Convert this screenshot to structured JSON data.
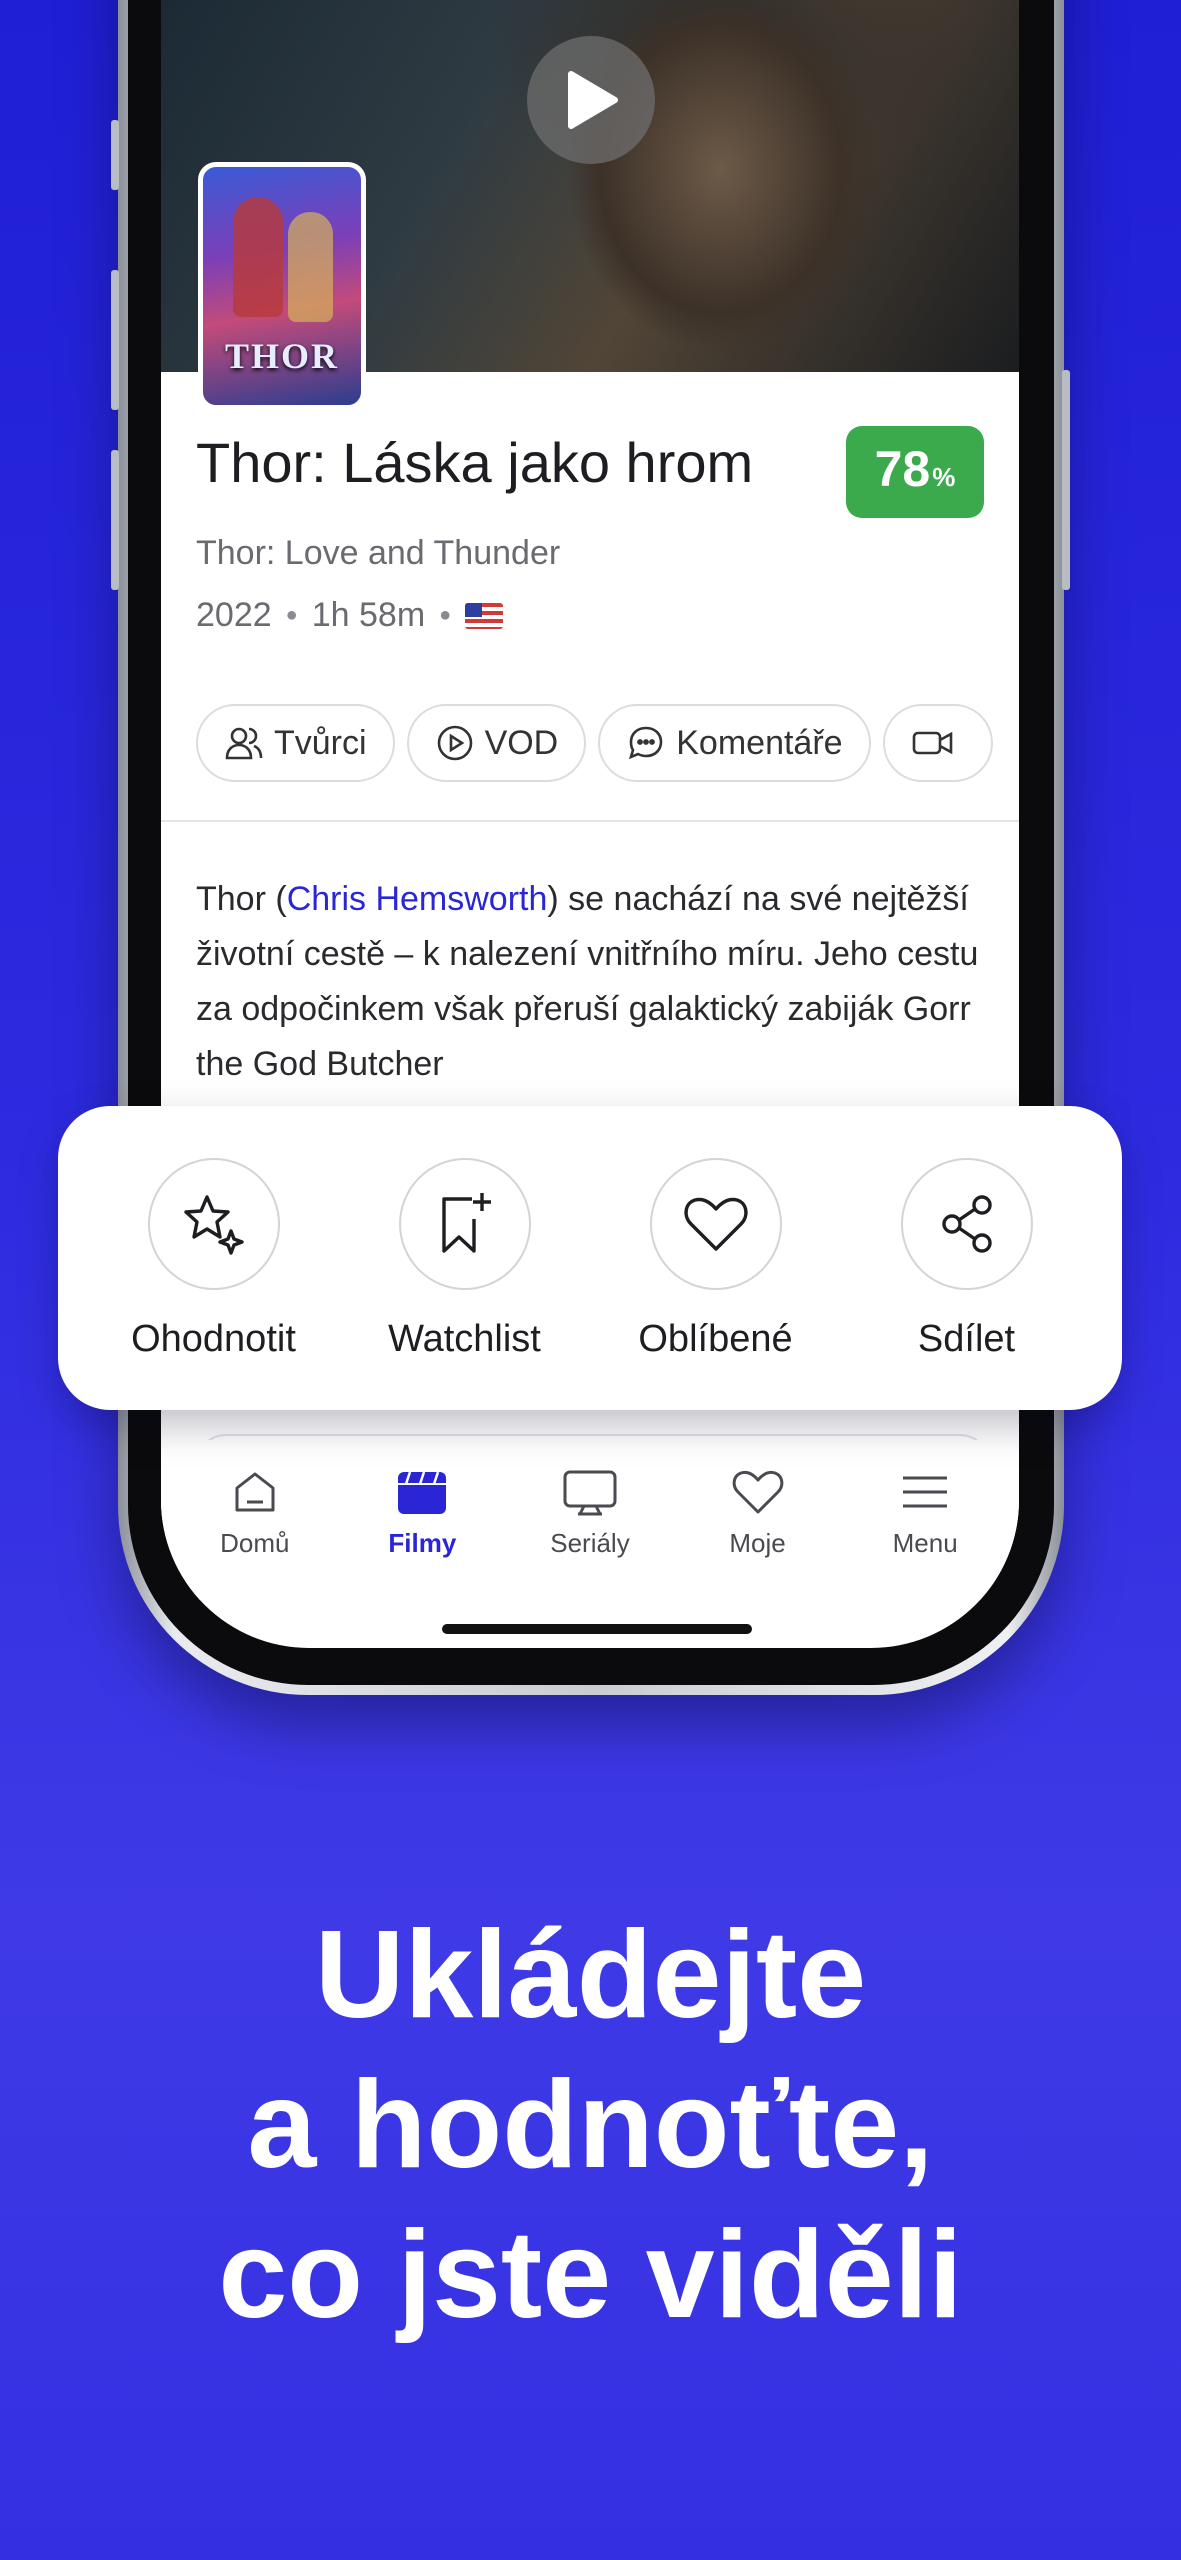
{
  "movie": {
    "title": "Thor: Láska jako hrom",
    "original_title": "Thor: Love and Thunder",
    "year": "2022",
    "duration": "1h 58m",
    "country_flag": "us-flag-icon",
    "score": "78",
    "score_unit": "%",
    "score_color": "#3aaa4c",
    "poster_text": "THOR"
  },
  "chips": [
    {
      "label": "Tvůrci",
      "icon": "people-icon"
    },
    {
      "label": "VOD",
      "icon": "play-circle-icon"
    },
    {
      "label": "Komentáře",
      "icon": "chat-icon"
    },
    {
      "label": "",
      "icon": "video-icon"
    }
  ],
  "description": {
    "before": "Thor (",
    "link": "Chris Hemsworth",
    "after": ") se nachází na své nejtěžší životní cestě – k nalezení vnitřního míru. Jeho cestu za odpočinkem však přeruší galaktický zabiják Gorr the God Butcher"
  },
  "actions": [
    {
      "label": "Ohodnotit",
      "icon": "star-sparkle-icon"
    },
    {
      "label": "Watchlist",
      "icon": "bookmark-plus-icon"
    },
    {
      "label": "Oblíbené",
      "icon": "heart-icon"
    },
    {
      "label": "Sdílet",
      "icon": "share-icon"
    }
  ],
  "tabs": [
    {
      "label": "Domů",
      "icon": "home-icon",
      "active": false
    },
    {
      "label": "Filmy",
      "icon": "film-icon",
      "active": true
    },
    {
      "label": "Seriály",
      "icon": "tv-icon",
      "active": false
    },
    {
      "label": "Moje",
      "icon": "heart-icon",
      "active": false
    },
    {
      "label": "Menu",
      "icon": "menu-icon",
      "active": false
    }
  ],
  "headline": [
    "Ukládejte",
    "a hodnoťte,",
    "co jste viděli"
  ],
  "colors": {
    "accent": "#2a26d6",
    "background": "#2a28de"
  }
}
